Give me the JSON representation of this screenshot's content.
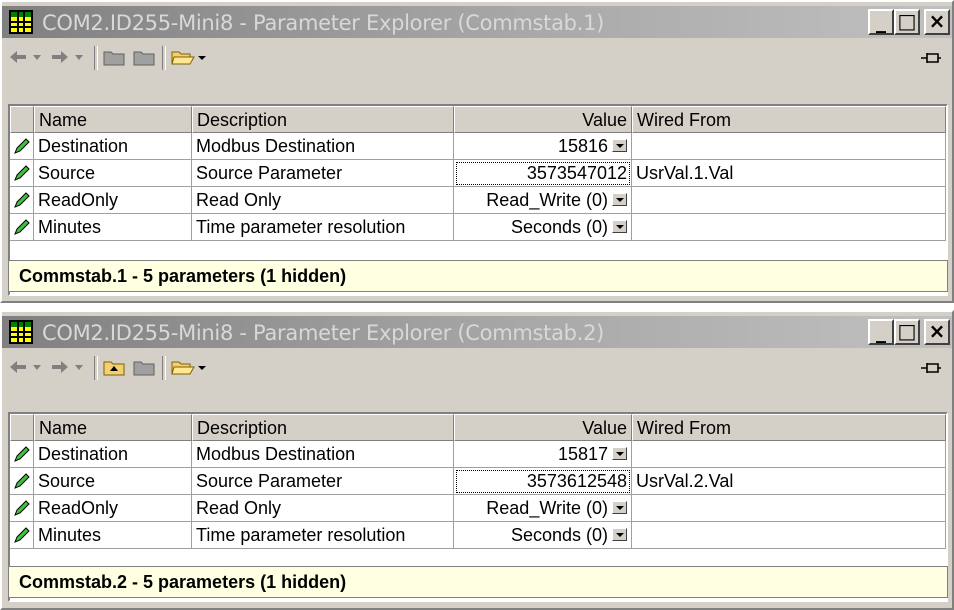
{
  "windows": [
    {
      "title": "COM2.ID255-Mini8 - Parameter Explorer (Commstab.1)",
      "caption_buttons": {
        "minimize": "_",
        "maximize": "□",
        "close": "×"
      },
      "toolbar": {
        "back": "back-arrow-icon",
        "forward": "forward-arrow-icon",
        "folder1": "folder-icon",
        "folder2": "folder-icon",
        "open": "open-folder-icon",
        "pin": "pin-icon"
      },
      "columns": [
        "Name",
        "Description",
        "Value",
        "Wired From"
      ],
      "rows": [
        {
          "name": "Destination",
          "description": "Modbus Destination",
          "value": "15816",
          "wired_from": ""
        },
        {
          "name": "Source",
          "description": "Source Parameter",
          "value": "3573547012",
          "wired_from": "UsrVal.1.Val"
        },
        {
          "name": "ReadOnly",
          "description": "Read Only",
          "value": "Read_Write (0)",
          "wired_from": ""
        },
        {
          "name": "Minutes",
          "description": "Time parameter resolution",
          "value": "Seconds (0)",
          "wired_from": ""
        }
      ],
      "status": "Commstab.1  -  5 parameters (1 hidden)"
    },
    {
      "title": "COM2.ID255-Mini8 - Parameter Explorer (Commstab.2)",
      "caption_buttons": {
        "minimize": "_",
        "maximize": "□",
        "close": "×"
      },
      "toolbar": {
        "back": "back-arrow-icon",
        "forward": "forward-arrow-icon",
        "folder1": "folder-up-icon",
        "folder2": "folder-icon",
        "open": "open-folder-icon",
        "pin": "pin-icon"
      },
      "columns": [
        "Name",
        "Description",
        "Value",
        "Wired From"
      ],
      "rows": [
        {
          "name": "Destination",
          "description": "Modbus Destination",
          "value": "15817",
          "wired_from": ""
        },
        {
          "name": "Source",
          "description": "Source Parameter",
          "value": "3573612548",
          "wired_from": "UsrVal.2.Val"
        },
        {
          "name": "ReadOnly",
          "description": "Read Only",
          "value": "Read_Write (0)",
          "wired_from": ""
        },
        {
          "name": "Minutes",
          "description": "Time parameter resolution",
          "value": "Seconds (0)",
          "wired_from": ""
        }
      ],
      "status": "Commstab.2  -  5 parameters (1 hidden)"
    }
  ],
  "colors": {
    "titlebar_inactive": "#808080",
    "status_bg": "#ffffe1",
    "chrome": "#d4d0c8"
  }
}
